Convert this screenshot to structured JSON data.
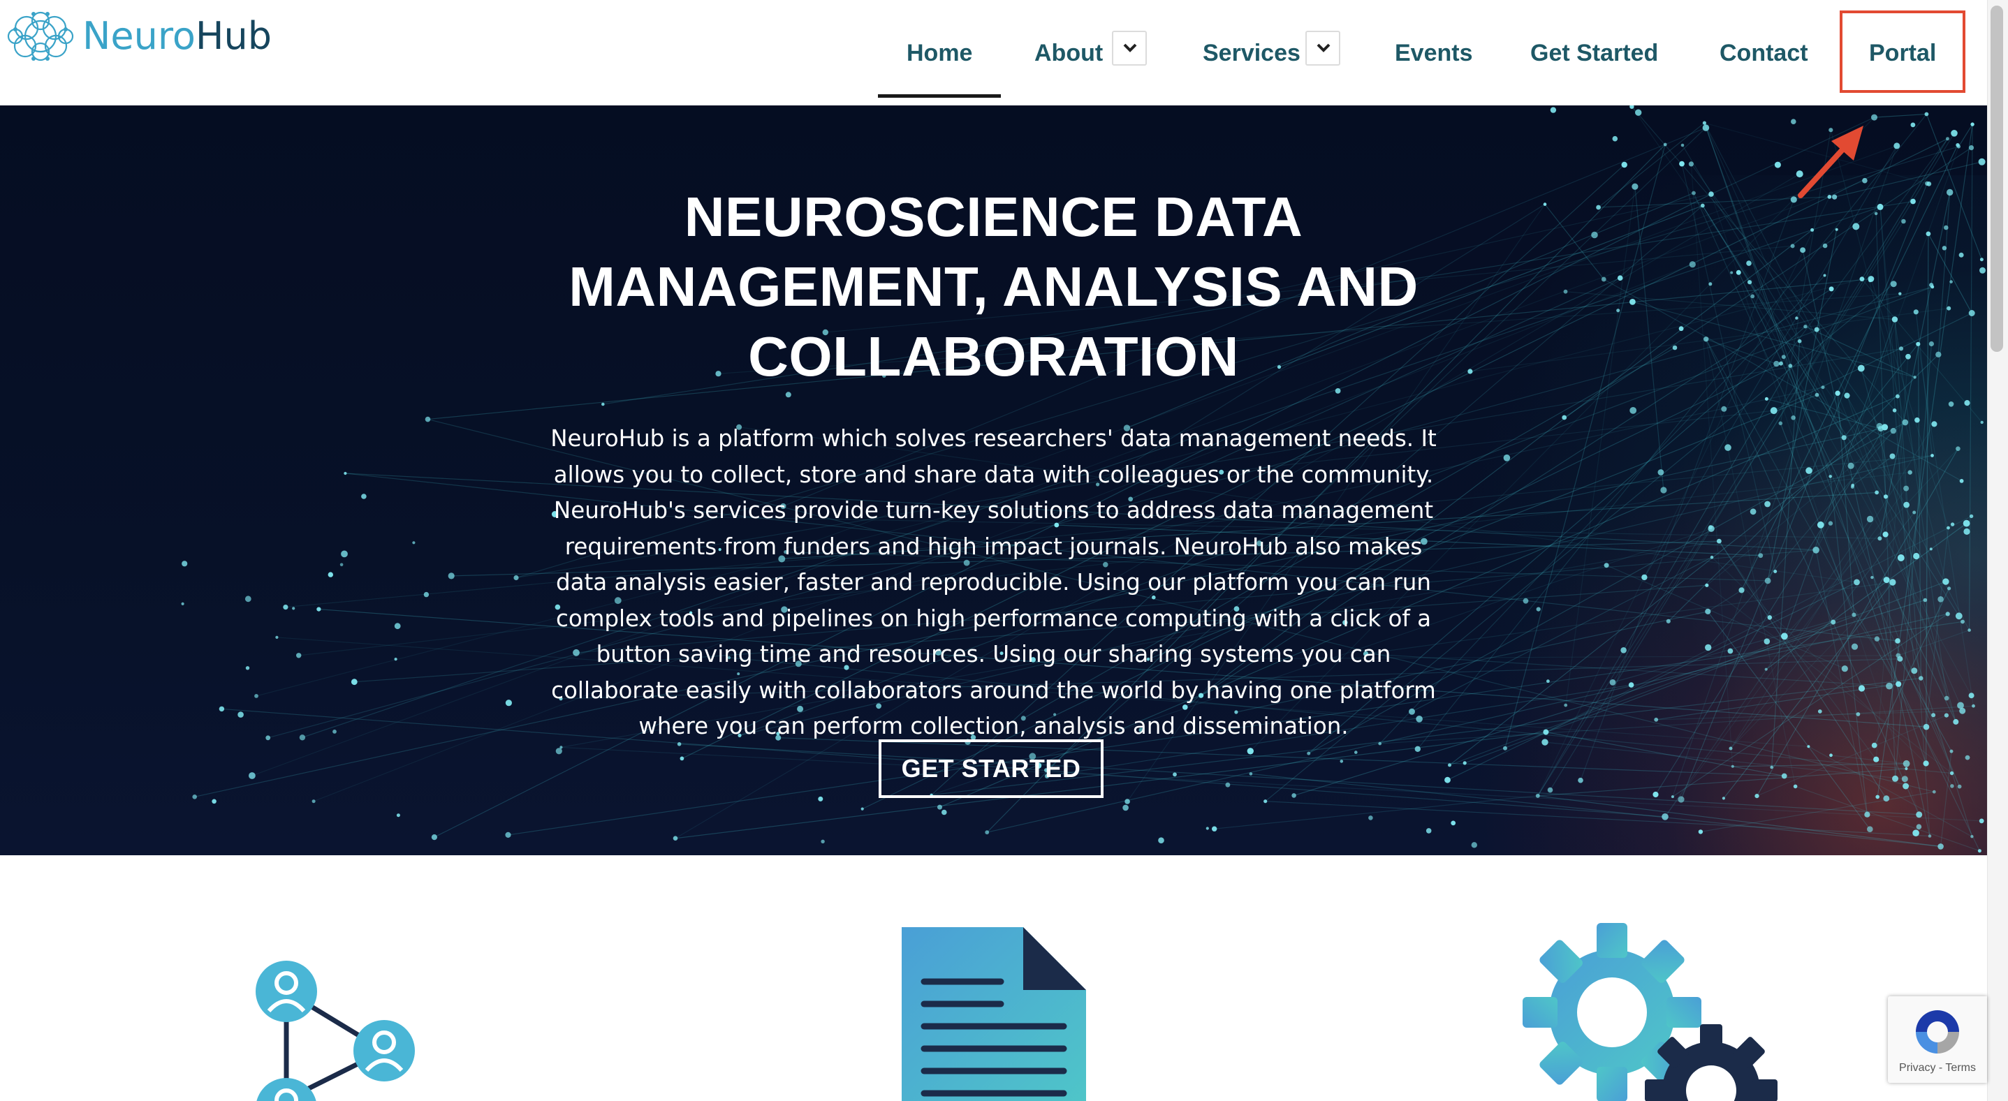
{
  "brand": {
    "name_part1": "Neuro",
    "name_part2": "Hub"
  },
  "nav": {
    "items": [
      {
        "label": "Home",
        "active": true
      },
      {
        "label": "About",
        "has_dropdown": true
      },
      {
        "label": "Services",
        "has_dropdown": true
      },
      {
        "label": "Events"
      },
      {
        "label": "Get Started"
      },
      {
        "label": "Contact"
      },
      {
        "label": "Portal",
        "highlighted": true
      }
    ]
  },
  "hero": {
    "title_lines": [
      "NEUROSCIENCE DATA",
      "MANAGEMENT, ANALYSIS AND",
      "COLLABORATION"
    ],
    "description": "NeuroHub is a platform which solves researchers' data management needs. It allows you to collect, store and share data with colleagues or the community. NeuroHub's services provide turn-key solutions to address data management requirements from funders and high impact journals. NeuroHub also makes data analysis easier, faster and reproducible. Using our platform you can run complex tools and pipelines on high performance computing with a click of a button saving time and resources. Using our sharing systems you can collaborate easily with collaborators around the world by having one platform where you can perform collection, analysis and dissemination.",
    "cta_label": "GET STARTED"
  },
  "features": {
    "icons": [
      "collaboration-network-icon",
      "document-icon",
      "gears-icon"
    ]
  },
  "recaptcha": {
    "links": "Privacy - Terms"
  },
  "colors": {
    "nav_text": "#1e5866",
    "brand_light": "#3aa3c8",
    "brand_dark": "#16455d",
    "hero_bg": "#050d22",
    "annotation_red": "#e24a32",
    "icon_blue": "#4ab6d6",
    "icon_navy": "#1b2b49"
  }
}
